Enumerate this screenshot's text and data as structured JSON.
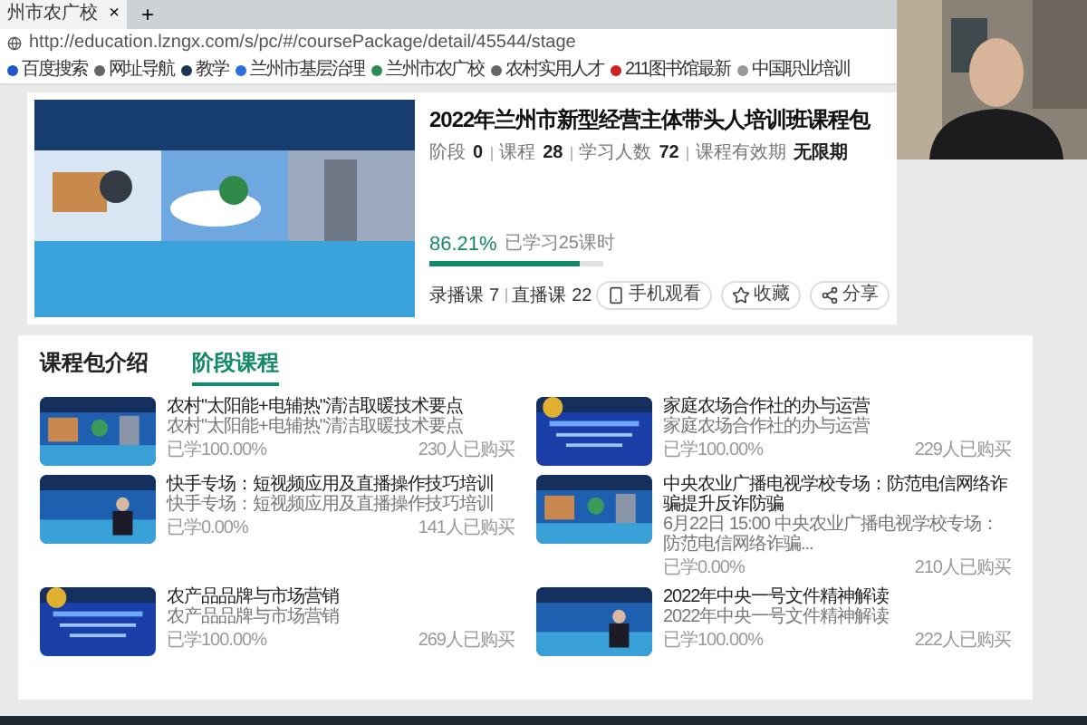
{
  "browser": {
    "tab": {
      "title": "州市农广校",
      "close": "×"
    },
    "new_tab": "+",
    "address": "http://education.lzngx.com/s/pc/#/coursePackage/detail/45544/stage",
    "bookmarks": [
      {
        "label": "百度搜索",
        "color": "#2255cc"
      },
      {
        "label": "网址导航",
        "color": "#666666"
      },
      {
        "label": "教学",
        "color": "#1d3557"
      },
      {
        "label": "兰州市基层治理",
        "color": "#2a6fdb"
      },
      {
        "label": "兰州市农广校",
        "color": "#2e8b57"
      },
      {
        "label": "农村实用人才",
        "color": "#666666"
      },
      {
        "label": "211图书馆最新",
        "color": "#cc2222"
      },
      {
        "label": "中国职业培训",
        "color": "#999999"
      }
    ]
  },
  "package": {
    "title": "2022年兰州市新型经营主体带头人培训班课程包",
    "meta": [
      {
        "label": "阶段",
        "value": "0"
      },
      {
        "label": "课程",
        "value": "28"
      },
      {
        "label": "学习人数",
        "value": "72"
      },
      {
        "label": "课程有效期",
        "value": "无限期"
      }
    ],
    "progress": {
      "percent": "86.21%",
      "note": "已学习25课时",
      "level": 0.8621
    },
    "counts": [
      {
        "label": "录播课",
        "value": "7"
      },
      {
        "label": "直播课",
        "value": "22"
      }
    ],
    "actions": [
      {
        "kind": "phone",
        "label": "手机观看"
      },
      {
        "kind": "star",
        "label": "收藏"
      },
      {
        "kind": "share",
        "label": "分享"
      }
    ]
  },
  "tabs": [
    {
      "label": "课程包介绍",
      "selected": false
    },
    {
      "label": "阶段课程",
      "selected": true
    }
  ],
  "courses": [
    {
      "title": "农村\"太阳能+电辅热\"清洁取暖技术要点",
      "subtitle": "农村\"太阳能+电辅热\"清洁取暖技术要点",
      "studied": "已学100.00%",
      "buyers": "230人已购买"
    },
    {
      "title": "家庭农场合作社的办与运营",
      "subtitle": "家庭农场合作社的办与运营",
      "studied": "已学100.00%",
      "buyers": "229人已购买"
    },
    {
      "title": "快手专场：短视频应用及直播操作技巧培训",
      "subtitle": "快手专场：短视频应用及直播操作技巧培训",
      "studied": "已学0.00%",
      "buyers": "141人已购买"
    },
    {
      "title": "中央农业广播电视学校专场：防范电信网络诈骗提升反诈防骗",
      "subtitle": "6月22日 15:00 中央农业广播电视学校专场：防范电信网络诈骗...",
      "studied": "已学0.00%",
      "buyers": "210人已购买"
    },
    {
      "title": "农产品品牌与市场营销",
      "subtitle": "农产品品牌与市场营销",
      "studied": "已学100.00%",
      "buyers": "269人已购买"
    },
    {
      "title": "2022年中央一号文件精神解读",
      "subtitle": "2022年中央一号文件精神解读",
      "studied": "已学100.00%",
      "buyers": "222人已购买"
    }
  ]
}
